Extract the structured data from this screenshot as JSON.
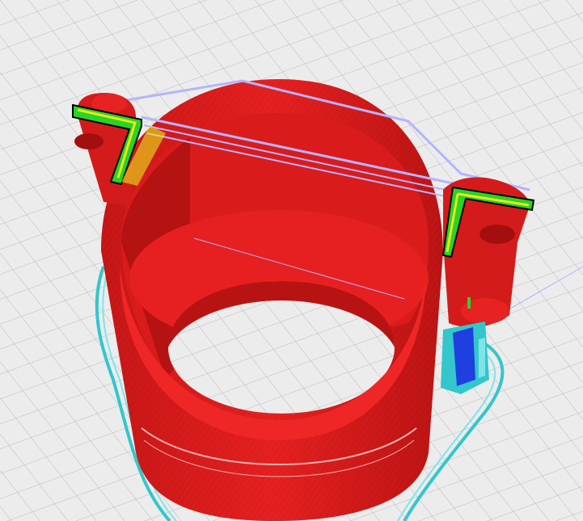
{
  "app": {
    "view": "slicer-preview-3d"
  },
  "scene": {
    "background_color": "#ececec",
    "grid_line_color": "#b9b9b9",
    "model_color": "#e01d1d",
    "model_shadow_color": "#a31010",
    "travel_move_color": "#b4b4ff",
    "skirt_color": "#33c6cc",
    "infill_green_color": "#28d428",
    "infill_yellow_color": "#e9e91a",
    "support_blue_color": "#1f3fe0"
  }
}
